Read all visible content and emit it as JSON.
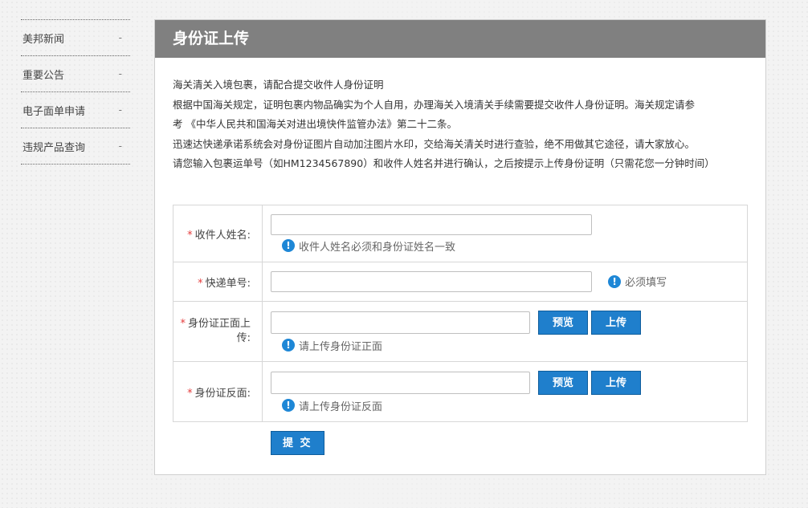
{
  "sidebar": {
    "items": [
      {
        "label": "美邦新闻",
        "marker": "-"
      },
      {
        "label": "重要公告",
        "marker": "-"
      },
      {
        "label": "电子面单申请",
        "marker": "-"
      },
      {
        "label": "违规产品查询",
        "marker": "-"
      }
    ]
  },
  "panel": {
    "title": "身份证上传",
    "intro": [
      "海关清关入境包裹，请配合提交收件人身份证明",
      "根据中国海关规定，证明包裹内物品确实为个人自用，办理海关入境清关手续需要提交收件人身份证明。海关规定请参",
      "考 《中华人民共和国海关对进出境快件监管办法》第二十二条。",
      "迅速达快递承诺系统会对身份证图片自动加注图片水印，交给海关清关时进行查验，绝不用做其它途径，请大家放心。",
      "请您输入包裹运单号（如HM1234567890）和收件人姓名并进行确认，之后按提示上传身份证明（只需花您一分钟时间）"
    ]
  },
  "form": {
    "required_mark": "*",
    "recipient": {
      "label": "收件人姓名:",
      "value": "",
      "hint": "收件人姓名必须和身份证姓名一致"
    },
    "tracking": {
      "label": "快递单号:",
      "value": "",
      "hint": "必须填写"
    },
    "id_front": {
      "label": "身份证正面上传:",
      "value": "",
      "hint": "请上传身份证正面",
      "preview_label": "预览",
      "upload_label": "上传"
    },
    "id_back": {
      "label": "身份证反面:",
      "value": "",
      "hint": "请上传身份证反面",
      "preview_label": "预览",
      "upload_label": "上传"
    },
    "info_glyph": "!",
    "submit_label": "提 交"
  },
  "colors": {
    "header_bg": "#808080",
    "button_bg": "#1f7fcc",
    "info_icon": "#1e87d6",
    "required_star": "#e53c3c"
  }
}
